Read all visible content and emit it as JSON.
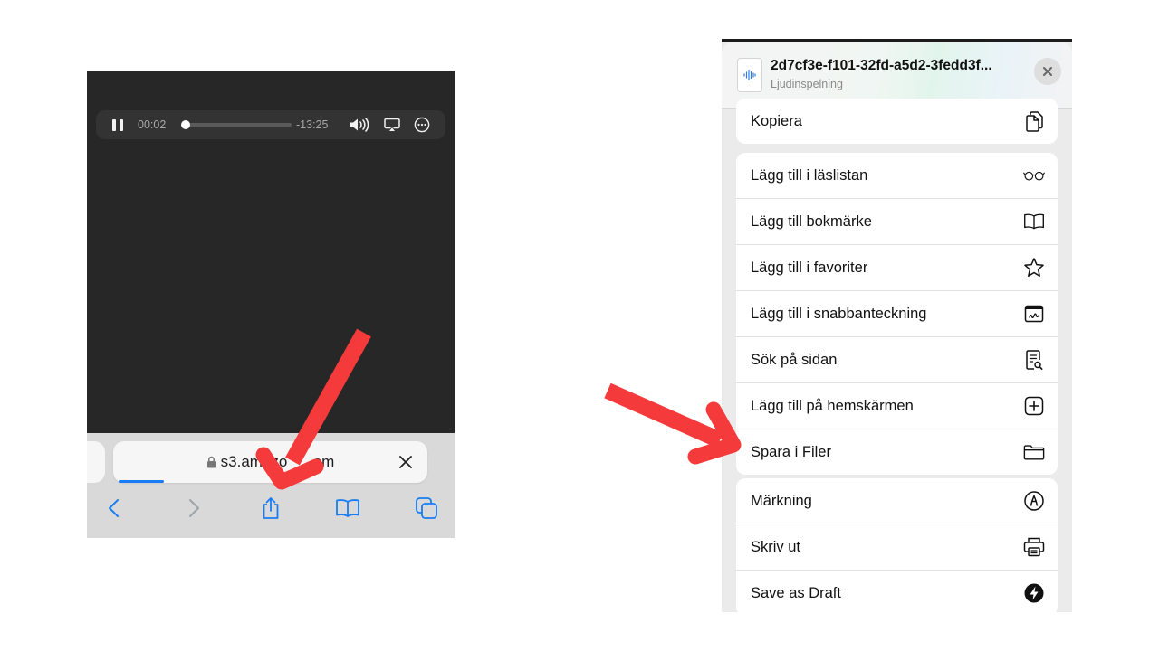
{
  "left": {
    "player": {
      "elapsed": "00:02",
      "remaining": "-13:25",
      "progress": 0.0
    },
    "url_bar": {
      "url_text": "s3.amazo      om"
    },
    "toolbar": {
      "back_icon": "chevron-left-icon",
      "forward_icon": "chevron-right-icon",
      "share_icon": "share-icon",
      "bookmarks_icon": "book-icon",
      "tabs_icon": "tabs-icon"
    }
  },
  "share_sheet": {
    "file_name": "2d7cf3e-f101-32fd-a5d2-3fedd3f...",
    "file_type": "Ljudinspelning",
    "groups": [
      [
        {
          "label": "Kopiera",
          "icon": "copy-icon"
        }
      ],
      [
        {
          "label": "Lägg till i läslistan",
          "icon": "glasses-icon"
        },
        {
          "label": "Lägg till bokmärke",
          "icon": "book-icon"
        },
        {
          "label": "Lägg till i favoriter",
          "icon": "star-icon"
        },
        {
          "label": "Lägg till i snabbanteckning",
          "icon": "quick-note-icon"
        },
        {
          "label": "Sök på sidan",
          "icon": "find-in-page-icon"
        },
        {
          "label": "Lägg till på hemskärmen",
          "icon": "add-square-icon"
        },
        {
          "label": "Spara i Filer",
          "icon": "folder-icon"
        }
      ],
      [
        {
          "label": "Märkning",
          "icon": "markup-icon"
        },
        {
          "label": "Skriv ut",
          "icon": "printer-icon"
        },
        {
          "label": "Save as Draft",
          "icon": "bolt-icon"
        }
      ]
    ]
  },
  "colors": {
    "annotation_arrow": "#f43a3a",
    "ios_blue": "#1a7cf2"
  }
}
